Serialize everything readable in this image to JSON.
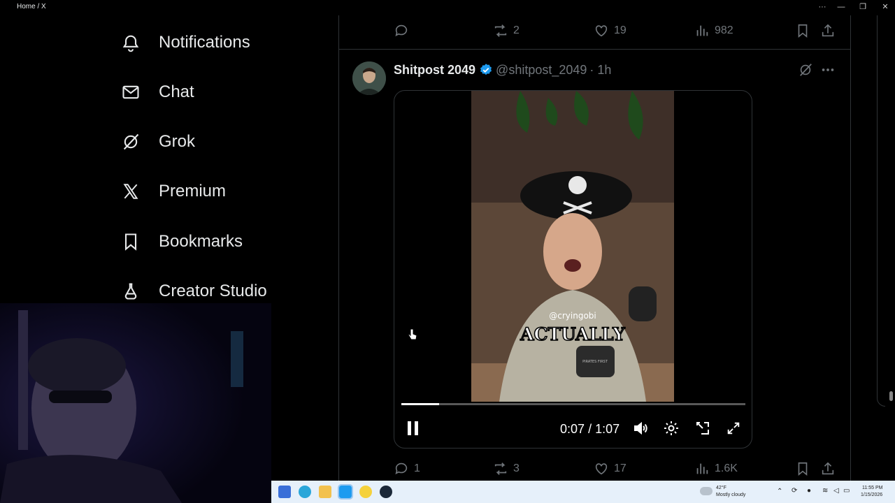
{
  "window": {
    "title": "Home / X",
    "controls": [
      "···",
      "—",
      "❐",
      "✕"
    ]
  },
  "sidebar": {
    "items": [
      {
        "label": "Notifications",
        "icon": "bell-icon"
      },
      {
        "label": "Chat",
        "icon": "mail-icon"
      },
      {
        "label": "Grok",
        "icon": "grok-icon"
      },
      {
        "label": "Premium",
        "icon": "x-logo-icon"
      },
      {
        "label": "Bookmarks",
        "icon": "bookmark-icon"
      },
      {
        "label": "Creator Studio",
        "icon": "flask-icon"
      }
    ]
  },
  "prev_post": {
    "replies": "",
    "reposts": "2",
    "likes": "19",
    "views": "982"
  },
  "post": {
    "author_name": "Shitpost 2049",
    "handle": "@shitpost_2049",
    "time": "· 1h",
    "verified": true,
    "video": {
      "overlay_handle": "@cryingobi",
      "overlay_caption": "ACTUALLY",
      "mug_text": "PIRATES FIRST",
      "current_time": "0:07",
      "separator": "/",
      "duration": "1:07",
      "progress": 0.109
    },
    "stats": {
      "replies": "1",
      "reposts": "3",
      "likes": "17",
      "views": "1.6K"
    }
  },
  "taskbar": {
    "weather_temp": "42°F",
    "weather_desc": "Mostly cloudy",
    "clock_time": "11:55 PM",
    "clock_date": "1/15/2026"
  },
  "colors": {
    "background": "#000000",
    "text": "#e7e9ea",
    "muted": "#71767b",
    "verified": "#1d9bf0",
    "border": "#2f3336"
  }
}
